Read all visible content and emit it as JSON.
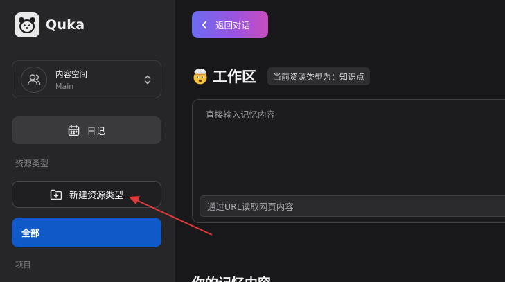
{
  "app": {
    "name": "Quka"
  },
  "space": {
    "title": "内容空间",
    "subtitle": "Main"
  },
  "sidebar": {
    "diary_label": "日记",
    "resource_types_label": "资源类型",
    "new_type_label": "新建资源类型",
    "all_label": "全部",
    "projects_label": "项目"
  },
  "main": {
    "back_label": "返回对话",
    "workspace_title": "工作区",
    "type_badge": "当前资源类型为：知识点",
    "editor_placeholder": "直接输入记忆内容",
    "url_placeholder": "通过URL读取网页内容",
    "memory_title": "你的记忆内容"
  },
  "colors": {
    "accent_blue": "#0f5ac8",
    "gradient": [
      "#6b6cf0",
      "#c94bc0"
    ],
    "annotation_arrow": "#e23a3a"
  },
  "icons": [
    "bear-logo-icon",
    "users-icon",
    "chevron-up-down-icon",
    "calendar-icon",
    "folder-plus-icon",
    "chevron-left-icon",
    "exploding-head-emoji-icon"
  ]
}
